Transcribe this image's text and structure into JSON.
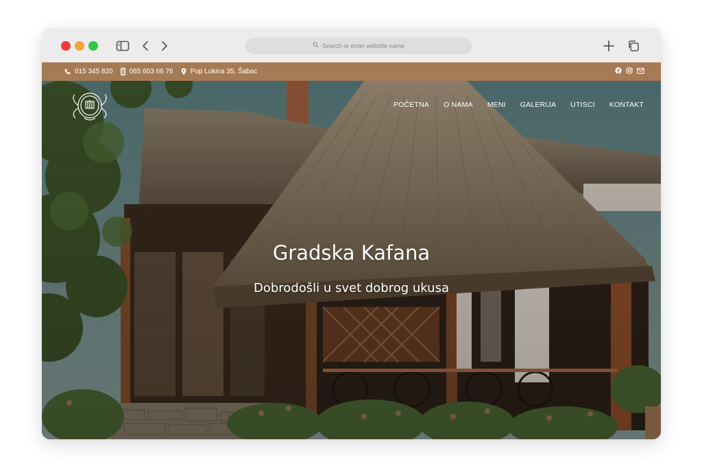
{
  "browser": {
    "address_placeholder": "Search or enter website name"
  },
  "topbar": {
    "phone": "015 345 820",
    "mobile": "065 603 66 76",
    "address": "Pop Lukina 35, Šabac",
    "social_icons": [
      "facebook-icon",
      "instagram-icon",
      "mail-icon"
    ]
  },
  "nav": {
    "items": [
      "POČETNA",
      "O NAMA",
      "MENI",
      "GALERIJA",
      "UTISCI",
      "KONTAKT"
    ]
  },
  "hero": {
    "title": "Gradska Kafana",
    "subtitle": "Dobrodošli u svet dobrog ukusa"
  },
  "colors": {
    "topbar": "#a57b55",
    "traffic_red": "#ee3b3a",
    "traffic_yellow": "#f2a33a",
    "traffic_green": "#33c548"
  }
}
